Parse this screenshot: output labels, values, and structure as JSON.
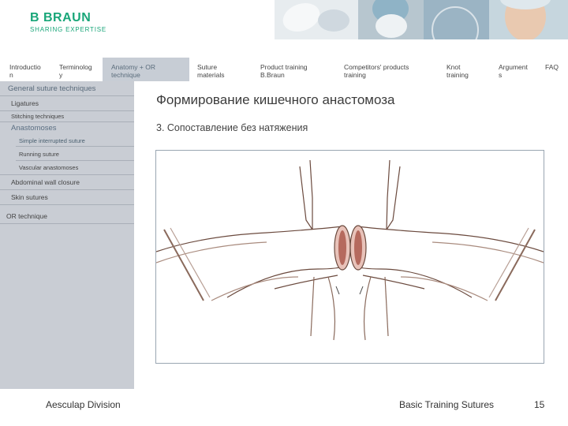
{
  "header": {
    "logo_brand": "B BRAUN",
    "logo_tagline": "SHARING EXPERTISE"
  },
  "nav": {
    "items": [
      {
        "label": "Introductio\nn"
      },
      {
        "label": "Terminolog\ny"
      },
      {
        "label": "Anatomy + OR\ntechnique"
      },
      {
        "label": "Suture\nmaterials"
      },
      {
        "label": "Product training\nB.Braun"
      },
      {
        "label": "Competitors' products\ntraining"
      },
      {
        "label": "Knot\ntraining"
      },
      {
        "label": "Argument\ns"
      },
      {
        "label": "FAQ"
      }
    ]
  },
  "sidebar": {
    "heading": "General suture techniques",
    "items": [
      {
        "label": "Ligatures"
      },
      {
        "label": "Stitching techniques"
      },
      {
        "label": "Anastomoses"
      },
      {
        "label": "Simple interrupted suture"
      },
      {
        "label": "Running suture"
      },
      {
        "label": "Vascular anastomoses"
      },
      {
        "label": "Abdominal wall closure"
      },
      {
        "label": "Skin sutures"
      },
      {
        "label": "OR technique"
      }
    ]
  },
  "main": {
    "title": "Формирование кишечного анастомоза",
    "subtitle": "3. Сопоставление без натяжения"
  },
  "footer": {
    "division": "Aesculap Division",
    "course": "Basic Training Sutures",
    "page": "15"
  },
  "colors": {
    "brand": "#19a679",
    "sidebar_bg": "#c9cdd4",
    "active_nav": "#c7cdd5",
    "tissue_stroke": "#6b4a3e",
    "figure_border": "#9aa6b2"
  }
}
